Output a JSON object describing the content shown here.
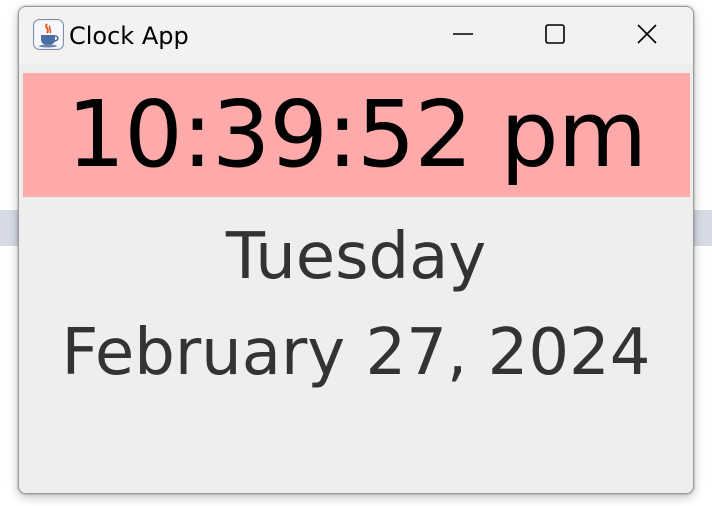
{
  "window": {
    "title": "Clock App",
    "icon": "java-coffee-cup-icon",
    "controls": {
      "minimize": "minimize-icon",
      "maximize": "maximize-icon",
      "close": "close-icon"
    }
  },
  "clock": {
    "time": "10:39:52 pm",
    "day": "Tuesday",
    "date": "February 27, 2024"
  },
  "colors": {
    "time_background": "#ffaaaa",
    "window_background": "#eeeeee",
    "text": "#333333"
  }
}
